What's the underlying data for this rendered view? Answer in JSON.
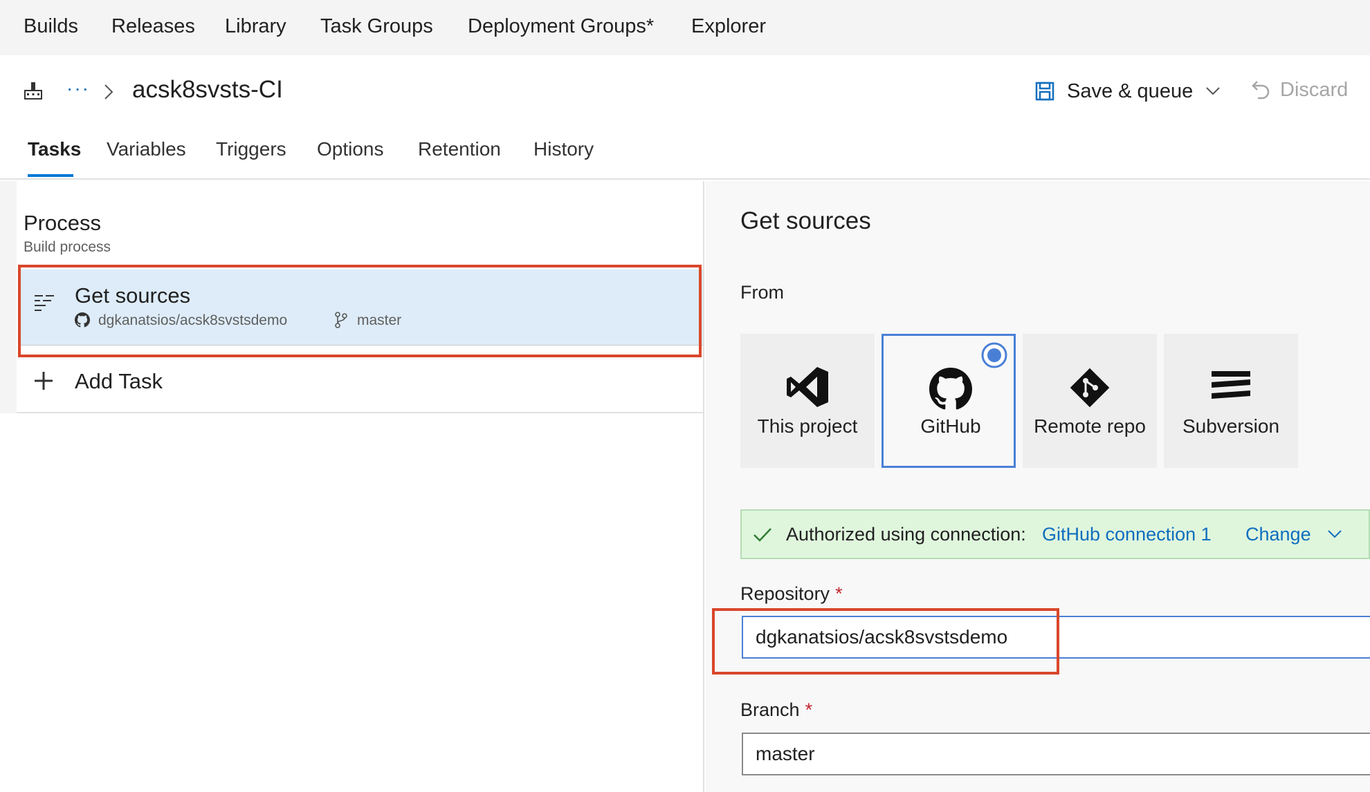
{
  "topnav": {
    "items": [
      "Builds",
      "Releases",
      "Library",
      "Task Groups",
      "Deployment Groups*",
      "Explorer"
    ]
  },
  "breadcrumb": {
    "ellipsis": "···",
    "title": "acsk8svsts-CI"
  },
  "toolbar": {
    "save_label": "Save & queue",
    "discard_label": "Discard"
  },
  "tabs": [
    "Tasks",
    "Variables",
    "Triggers",
    "Options",
    "Retention",
    "History"
  ],
  "process": {
    "title": "Process",
    "subtitle": "Build process"
  },
  "get_sources_item": {
    "title": "Get sources",
    "repo": "dgkanatsios/acsk8svstsdemo",
    "branch": "master"
  },
  "add_task": {
    "label": "Add Task"
  },
  "right_panel": {
    "title": "Get sources",
    "from_label": "From",
    "sources": [
      {
        "label": "This project",
        "icon": "visual-studio-icon"
      },
      {
        "label": "GitHub",
        "icon": "github-icon",
        "selected": true
      },
      {
        "label": "Remote repo",
        "icon": "git-icon"
      },
      {
        "label": "Subversion",
        "icon": "subversion-icon"
      }
    ],
    "auth": {
      "text": "Authorized using connection:",
      "connection": "GitHub connection 1",
      "change": "Change"
    },
    "repository": {
      "label": "Repository",
      "required": "*",
      "value": "dgkanatsios/acsk8svstsdemo"
    },
    "branch": {
      "label": "Branch",
      "required": "*",
      "value": "master"
    }
  },
  "colors": {
    "accent": "#0078d4",
    "link": "#106ebe",
    "selected_row": "#deecf9",
    "highlight_box": "#d9472b",
    "auth_bg": "#dff6dd",
    "required": "#c4262e"
  }
}
